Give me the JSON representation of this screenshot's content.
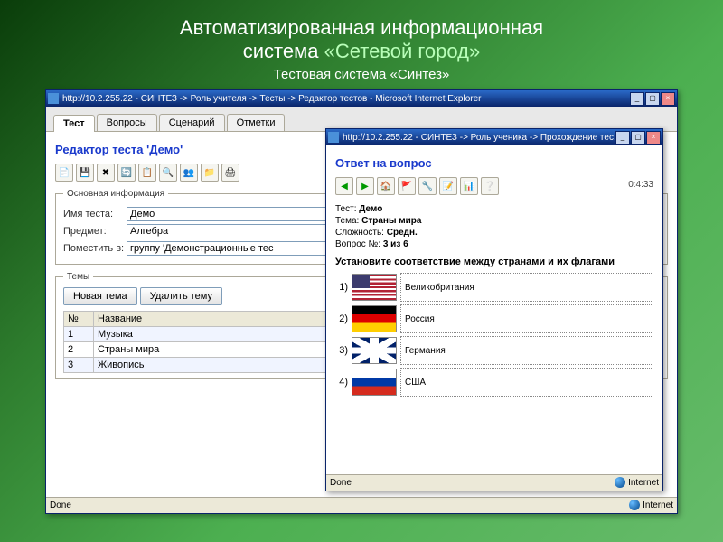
{
  "slide": {
    "title_a": "Автоматизированная информационная",
    "title_b": "система",
    "title_hl": "«Сетевой город»",
    "subtitle": "Тестовая система «Синтез»"
  },
  "main_window": {
    "title": "http://10.2.255.22 - СИНТЕЗ -> Роль учителя -> Тесты -> Редактор тестов - Microsoft Internet Explorer",
    "tabs": [
      "Тест",
      "Вопросы",
      "Сценарий",
      "Отметки"
    ],
    "active_tab": 0,
    "page_title": "Редактор теста 'Демо'",
    "section_main_legend": "Основная информация",
    "fields": {
      "name_label": "Имя теста:",
      "name_value": "Демо",
      "subject_label": "Предмет:",
      "subject_value": "Алгебра",
      "place_label": "Поместить в:",
      "place_value": "группу 'Демонстрационные тес"
    },
    "section_themes_legend": "Темы",
    "buttons": {
      "new_theme": "Новая тема",
      "del_theme": "Удалить тему"
    },
    "themes_header": {
      "num": "№",
      "name": "Название"
    },
    "themes": [
      {
        "num": "1",
        "name": "Музыка"
      },
      {
        "num": "2",
        "name": "Страны мира"
      },
      {
        "num": "3",
        "name": "Живопись"
      }
    ],
    "status": {
      "done": "Done",
      "zone": "Internet"
    }
  },
  "popup": {
    "title": "http://10.2.255.22 - СИНТЕЗ -> Роль ученика -> Прохождение тес...",
    "page_title": "Ответ на вопрос",
    "timer": "0:4:33",
    "info": {
      "test_label": "Тест:",
      "test": "Демо",
      "theme_label": "Тема:",
      "theme": "Страны мира",
      "diff_label": "Сложность:",
      "diff": "Средн.",
      "qnum_label": "Вопрос №:",
      "qnum": "3 из 6"
    },
    "question": "Установите соответствие между странами и их флагами",
    "rows": [
      {
        "num": "1)",
        "flag": "usa",
        "answer": "Великобритания"
      },
      {
        "num": "2)",
        "flag": "de",
        "answer": "Россия"
      },
      {
        "num": "3)",
        "flag": "uk",
        "answer": "Германия"
      },
      {
        "num": "4)",
        "flag": "ru",
        "answer": "США"
      }
    ],
    "status": {
      "done": "Done",
      "zone": "Internet"
    }
  }
}
